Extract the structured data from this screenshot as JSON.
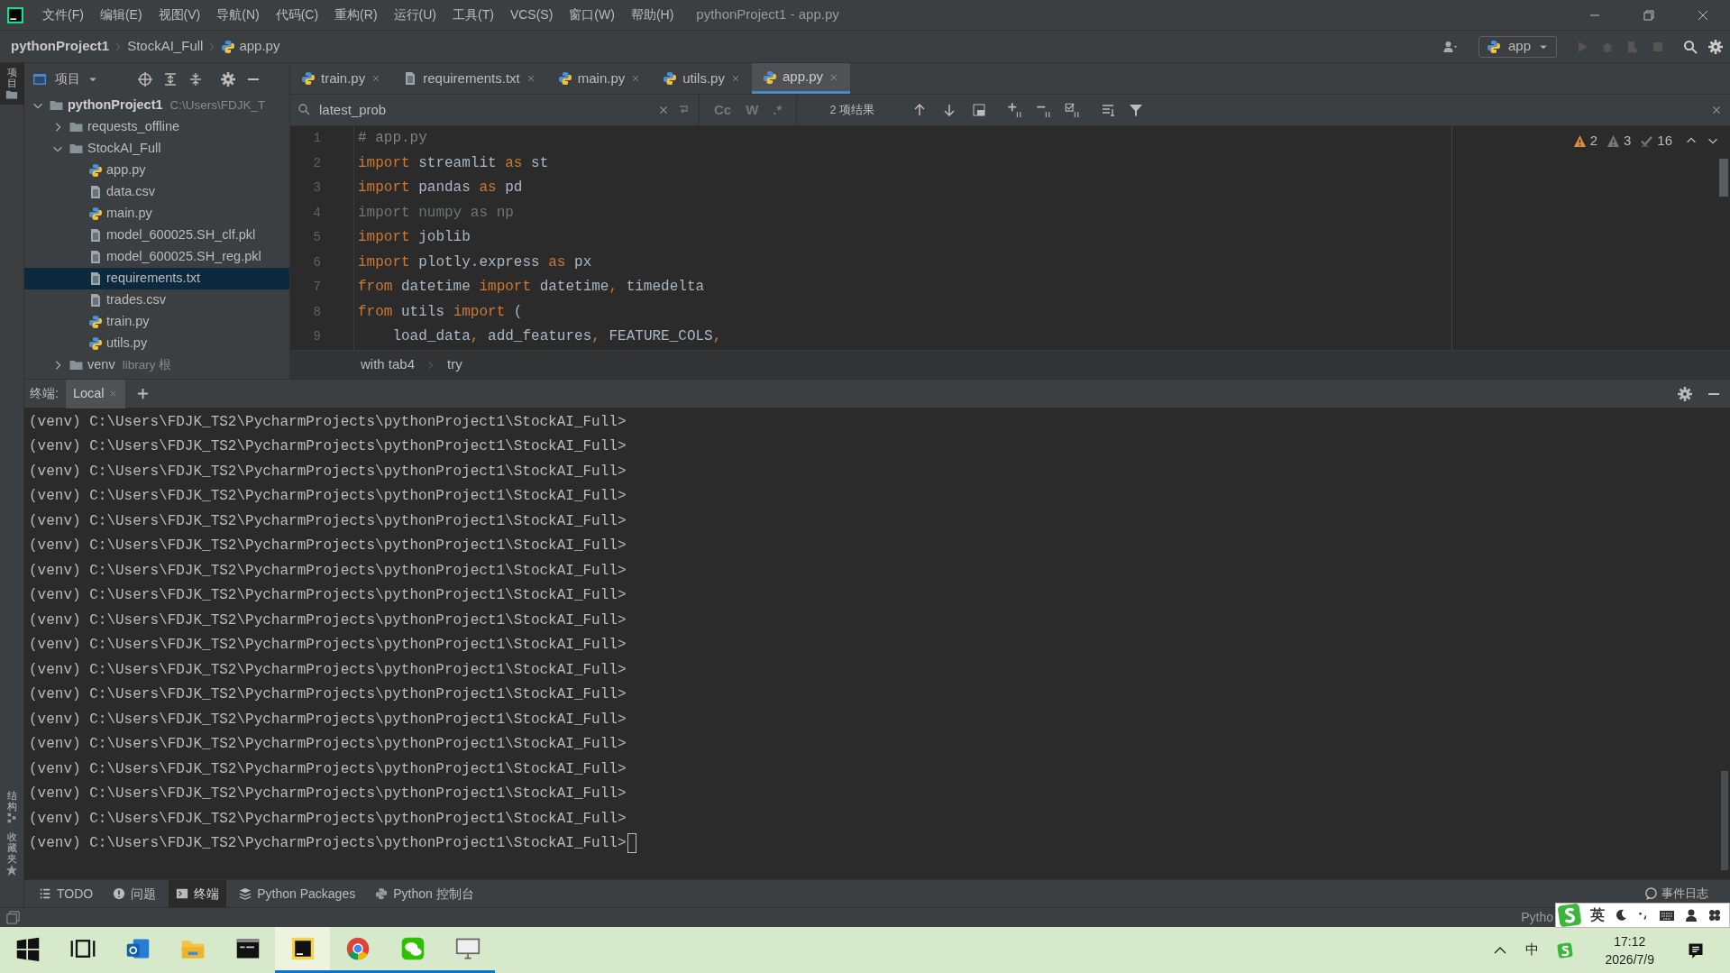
{
  "title_bar": {
    "menus": [
      "文件(F)",
      "编辑(E)",
      "视图(V)",
      "导航(N)",
      "代码(C)",
      "重构(R)",
      "运行(U)",
      "工具(T)",
      "VCS(S)",
      "窗口(W)",
      "帮助(H)"
    ],
    "title": "pythonProject1 - app.py"
  },
  "nav_bar": {
    "breadcrumbs": [
      {
        "label": "pythonProject1",
        "kind": "project"
      },
      {
        "label": "StockAI_Full",
        "kind": "folder"
      },
      {
        "label": "app.py",
        "kind": "python"
      }
    ],
    "run_config": "app"
  },
  "left_strip": {
    "top": [
      "项目"
    ],
    "bottom": [
      "结构",
      "收藏夹"
    ]
  },
  "project_panel": {
    "title": "项目",
    "tree": [
      {
        "label": "pythonProject1",
        "path": "C:\\Users\\FDJK_T",
        "kind": "folder",
        "expanded": true,
        "selected": false,
        "children": [
          {
            "label": "requests_offline",
            "kind": "folder",
            "expanded": false,
            "selected": false
          },
          {
            "label": "StockAI_Full",
            "kind": "folder",
            "expanded": true,
            "selected": false,
            "children": [
              {
                "label": "app.py",
                "kind": "python",
                "selected": false
              },
              {
                "label": "data.csv",
                "kind": "text",
                "selected": false
              },
              {
                "label": "main.py",
                "kind": "python",
                "selected": false
              },
              {
                "label": "model_600025.SH_clf.pkl",
                "kind": "text",
                "selected": false
              },
              {
                "label": "model_600025.SH_reg.pkl",
                "kind": "text",
                "selected": false
              },
              {
                "label": "requirements.txt",
                "kind": "text",
                "selected": true
              },
              {
                "label": "trades.csv",
                "kind": "text",
                "selected": false
              },
              {
                "label": "train.py",
                "kind": "python",
                "selected": false
              },
              {
                "label": "utils.py",
                "kind": "python",
                "selected": false
              }
            ]
          },
          {
            "label": "venv",
            "path": "library 根",
            "kind": "folder",
            "expanded": false,
            "selected": false
          }
        ]
      }
    ]
  },
  "editor_tabs": [
    {
      "label": "train.py",
      "kind": "python",
      "selected": false
    },
    {
      "label": "requirements.txt",
      "kind": "text",
      "selected": false
    },
    {
      "label": "main.py",
      "kind": "python",
      "selected": false
    },
    {
      "label": "utils.py",
      "kind": "python",
      "selected": false
    },
    {
      "label": "app.py",
      "kind": "python",
      "selected": true
    }
  ],
  "search": {
    "value": "latest_prob",
    "toggles": [
      "Cc",
      "W",
      ".*"
    ],
    "results": "2 项结果"
  },
  "inspections": [
    {
      "kind": "error",
      "count": "2"
    },
    {
      "kind": "warning",
      "count": "3"
    },
    {
      "kind": "typo",
      "count": "16"
    }
  ],
  "code_lines": [
    {
      "number": "1",
      "tokens": [
        {
          "kind": "comment",
          "text": "# app.py"
        }
      ]
    },
    {
      "number": "2",
      "tokens": [
        {
          "kind": "keyword",
          "text": "import"
        },
        {
          "kind": "plain",
          "text": " streamlit "
        },
        {
          "kind": "keyword",
          "text": "as"
        },
        {
          "kind": "plain",
          "text": " st"
        }
      ]
    },
    {
      "number": "3",
      "tokens": [
        {
          "kind": "keyword",
          "text": "import"
        },
        {
          "kind": "plain",
          "text": " pandas "
        },
        {
          "kind": "keyword",
          "text": "as"
        },
        {
          "kind": "plain",
          "text": " pd"
        }
      ]
    },
    {
      "number": "4",
      "tokens": [
        {
          "kind": "unused",
          "text": "import numpy as np"
        }
      ]
    },
    {
      "number": "5",
      "tokens": [
        {
          "kind": "keyword",
          "text": "import"
        },
        {
          "kind": "plain",
          "text": " joblib"
        }
      ]
    },
    {
      "number": "6",
      "tokens": [
        {
          "kind": "keyword",
          "text": "import"
        },
        {
          "kind": "plain",
          "text": " plotly.express "
        },
        {
          "kind": "keyword",
          "text": "as"
        },
        {
          "kind": "plain",
          "text": " px"
        }
      ]
    },
    {
      "number": "7",
      "tokens": [
        {
          "kind": "keyword",
          "text": "from"
        },
        {
          "kind": "plain",
          "text": " datetime "
        },
        {
          "kind": "keyword",
          "text": "import"
        },
        {
          "kind": "plain",
          "text": " datetime"
        },
        {
          "kind": "keyword",
          "text": ","
        },
        {
          "kind": "plain",
          "text": " timedelta"
        }
      ]
    },
    {
      "number": "8",
      "tokens": [
        {
          "kind": "keyword",
          "text": "from"
        },
        {
          "kind": "plain",
          "text": " utils "
        },
        {
          "kind": "keyword",
          "text": "import"
        },
        {
          "kind": "plain",
          "text": " ("
        }
      ]
    },
    {
      "number": "9",
      "tokens": [
        {
          "kind": "plain",
          "text": "    load_data"
        },
        {
          "kind": "keyword",
          "text": ","
        },
        {
          "kind": "plain",
          "text": " add_features"
        },
        {
          "kind": "keyword",
          "text": ","
        },
        {
          "kind": "plain",
          "text": " FEATURE_COLS"
        },
        {
          "kind": "keyword",
          "text": ","
        }
      ]
    }
  ],
  "code_breadcrumb": [
    "with tab4",
    "try"
  ],
  "terminal": {
    "label": "终端:",
    "tabs": [
      {
        "label": "Local",
        "selected": true
      }
    ],
    "lines": [
      "(venv) C:\\Users\\FDJK_TS2\\PycharmProjects\\pythonProject1\\StockAI_Full>",
      "(venv) C:\\Users\\FDJK_TS2\\PycharmProjects\\pythonProject1\\StockAI_Full>",
      "(venv) C:\\Users\\FDJK_TS2\\PycharmProjects\\pythonProject1\\StockAI_Full>",
      "(venv) C:\\Users\\FDJK_TS2\\PycharmProjects\\pythonProject1\\StockAI_Full>",
      "(venv) C:\\Users\\FDJK_TS2\\PycharmProjects\\pythonProject1\\StockAI_Full>",
      "(venv) C:\\Users\\FDJK_TS2\\PycharmProjects\\pythonProject1\\StockAI_Full>",
      "(venv) C:\\Users\\FDJK_TS2\\PycharmProjects\\pythonProject1\\StockAI_Full>",
      "(venv) C:\\Users\\FDJK_TS2\\PycharmProjects\\pythonProject1\\StockAI_Full>",
      "(venv) C:\\Users\\FDJK_TS2\\PycharmProjects\\pythonProject1\\StockAI_Full>",
      "(venv) C:\\Users\\FDJK_TS2\\PycharmProjects\\pythonProject1\\StockAI_Full>",
      "(venv) C:\\Users\\FDJK_TS2\\PycharmProjects\\pythonProject1\\StockAI_Full>",
      "(venv) C:\\Users\\FDJK_TS2\\PycharmProjects\\pythonProject1\\StockAI_Full>",
      "(venv) C:\\Users\\FDJK_TS2\\PycharmProjects\\pythonProject1\\StockAI_Full>",
      "(venv) C:\\Users\\FDJK_TS2\\PycharmProjects\\pythonProject1\\StockAI_Full>",
      "(venv) C:\\Users\\FDJK_TS2\\PycharmProjects\\pythonProject1\\StockAI_Full>",
      "(venv) C:\\Users\\FDJK_TS2\\PycharmProjects\\pythonProject1\\StockAI_Full>",
      "(venv) C:\\Users\\FDJK_TS2\\PycharmProjects\\pythonProject1\\StockAI_Full>",
      "(venv) C:\\Users\\FDJK_TS2\\PycharmProjects\\pythonProject1\\StockAI_Full>"
    ]
  },
  "tool_tabs": [
    {
      "label": "TODO",
      "kind": "list",
      "selected": false
    },
    {
      "label": "问题",
      "kind": "problems",
      "selected": false
    },
    {
      "label": "终端",
      "kind": "terminal",
      "selected": true
    },
    {
      "label": "Python Packages",
      "kind": "packages",
      "selected": false
    },
    {
      "label": "Python 控制台",
      "kind": "console",
      "selected": false
    }
  ],
  "event_log": "事件日志",
  "status_bar": {
    "text": "Pytho"
  },
  "ime_toolbar": {
    "mode": "英"
  },
  "taskbar": {
    "apps": [
      {
        "kind": "start",
        "running": false,
        "active": false
      },
      {
        "kind": "taskview",
        "running": false,
        "active": false
      },
      {
        "kind": "mail",
        "running": false,
        "active": false
      },
      {
        "kind": "explorer",
        "running": false,
        "active": false
      },
      {
        "kind": "console",
        "running": false,
        "active": false
      },
      {
        "kind": "pycharm",
        "running": true,
        "active": true
      },
      {
        "kind": "chrome",
        "running": true,
        "active": false
      },
      {
        "kind": "wechat",
        "running": true,
        "active": false
      },
      {
        "kind": "monitor",
        "running": true,
        "active": false
      }
    ],
    "tray": {
      "ime": "中",
      "time": "17:12",
      "date": "2026/7/9"
    }
  }
}
